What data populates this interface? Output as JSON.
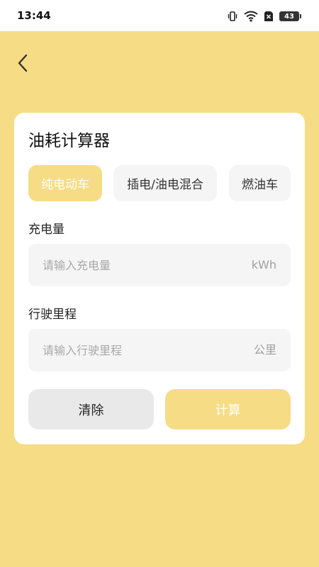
{
  "status_bar": {
    "time": "13:44",
    "battery": "43",
    "icons": [
      "vibrate-icon",
      "wifi-icon",
      "sim-icon",
      "battery-icon"
    ]
  },
  "header": {
    "back_icon": "chevron-left-icon"
  },
  "card": {
    "title": "油耗计算器",
    "tabs": [
      {
        "label": "纯电动车",
        "active": true
      },
      {
        "label": "插电/油电混合",
        "active": false
      },
      {
        "label": "燃油车",
        "active": false
      }
    ],
    "charge": {
      "label": "充电量",
      "placeholder": "请输入充电量",
      "value": "",
      "unit": "kWh"
    },
    "distance": {
      "label": "行驶里程",
      "placeholder": "请输入行驶里程",
      "value": "",
      "unit": "公里"
    },
    "buttons": {
      "clear": "清除",
      "calculate": "计算"
    }
  },
  "colors": {
    "background": "#F6DC84",
    "accent": "#F6DC84",
    "card": "#FFFFFF",
    "input_bg": "#F5F5F5",
    "clear_bg": "#E9E9E9"
  }
}
